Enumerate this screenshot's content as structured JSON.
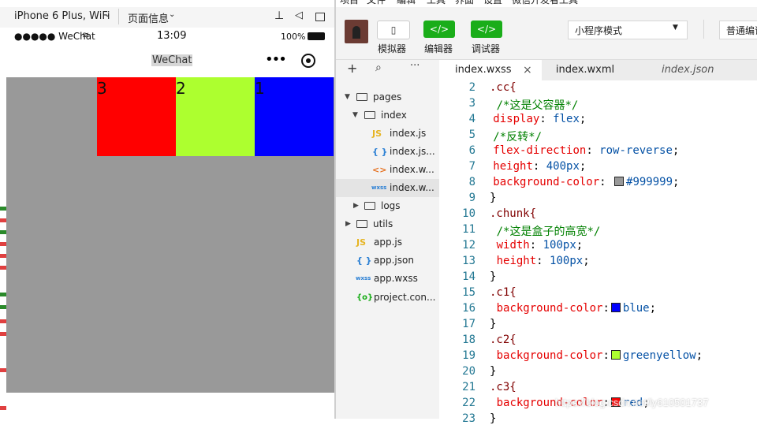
{
  "menu": [
    "项目",
    "文件",
    "编辑",
    "工具",
    "界面",
    "设置",
    "微信开发者工具"
  ],
  "device": {
    "model": "iPhone 6 Plus, WiFi",
    "page_info": "页面信息"
  },
  "status_bar": {
    "carrier": "●●●●● WeChat",
    "time": "13:09",
    "battery": "100%"
  },
  "navbar": {
    "title": "WeChat"
  },
  "stage": {
    "background": "#999999",
    "chunks": [
      {
        "label": "3",
        "color": "#ff0000"
      },
      {
        "label": "2",
        "color": "#adff2f"
      },
      {
        "label": "1",
        "color": "#0000ff"
      }
    ]
  },
  "toolbar": {
    "simulator": "模拟器",
    "editor": "编辑器",
    "debugger": "调试器",
    "mode": "小程序模式",
    "compile": "普通编译"
  },
  "tabs": [
    {
      "label": "index.wxss",
      "active": true
    },
    {
      "label": "index.wxml",
      "active": false
    },
    {
      "label": "index.json",
      "active": false
    }
  ],
  "tree": [
    {
      "label": "pages",
      "kind": "folder",
      "depth": 0,
      "expanded": true
    },
    {
      "label": "index",
      "kind": "folder",
      "depth": 1,
      "expanded": true
    },
    {
      "label": "index.js",
      "kind": "js",
      "depth": 2
    },
    {
      "label": "index.js...",
      "kind": "json",
      "depth": 2
    },
    {
      "label": "index.w...",
      "kind": "wxml",
      "depth": 2
    },
    {
      "label": "index.w...",
      "kind": "wxss",
      "depth": 2,
      "selected": true
    },
    {
      "label": "logs",
      "kind": "folder",
      "depth": 1,
      "expanded": false
    },
    {
      "label": "utils",
      "kind": "folder",
      "depth": 0,
      "expanded": false
    },
    {
      "label": "app.js",
      "kind": "js",
      "depth": 0
    },
    {
      "label": "app.json",
      "kind": "json",
      "depth": 0
    },
    {
      "label": "app.wxss",
      "kind": "wxss",
      "depth": 0
    },
    {
      "label": "project.con...",
      "kind": "config",
      "depth": 0
    }
  ],
  "code": [
    {
      "n": "2",
      "indent": 0,
      "parts": [
        [
          "sel",
          ".cc{"
        ]
      ]
    },
    {
      "n": "3",
      "indent": 2,
      "parts": [
        [
          "cmt",
          "/*这是父容器*/"
        ]
      ]
    },
    {
      "n": "4",
      "indent": 1,
      "parts": [
        [
          "prop",
          "display"
        ],
        [
          "txt",
          ": "
        ],
        [
          "val",
          "flex"
        ],
        [
          "txt",
          ";"
        ]
      ]
    },
    {
      "n": "5",
      "indent": 1,
      "parts": [
        [
          "cmt",
          "/*反转*/"
        ]
      ]
    },
    {
      "n": "6",
      "indent": 1,
      "parts": [
        [
          "prop",
          "flex-direction"
        ],
        [
          "txt",
          ": "
        ],
        [
          "val",
          "row-reverse"
        ],
        [
          "txt",
          ";"
        ]
      ]
    },
    {
      "n": "7",
      "indent": 1,
      "parts": [
        [
          "prop",
          "height"
        ],
        [
          "txt",
          ": "
        ],
        [
          "val",
          "400px"
        ],
        [
          "txt",
          ";"
        ]
      ]
    },
    {
      "n": "8",
      "indent": 1,
      "parts": [
        [
          "prop",
          "background-color"
        ],
        [
          "txt",
          ": "
        ],
        [
          "sw",
          "#999999"
        ],
        [
          "val",
          "#999999"
        ],
        [
          "txt",
          ";"
        ]
      ]
    },
    {
      "n": "9",
      "indent": 0,
      "parts": [
        [
          "txt",
          "}"
        ]
      ]
    },
    {
      "n": "10",
      "indent": 0,
      "parts": [
        [
          "sel",
          ".chunk{"
        ]
      ]
    },
    {
      "n": "11",
      "indent": 2,
      "parts": [
        [
          "cmt",
          "/*这是盒子的高宽*/"
        ]
      ]
    },
    {
      "n": "12",
      "indent": 2,
      "parts": [
        [
          "prop",
          "width"
        ],
        [
          "txt",
          ": "
        ],
        [
          "val",
          "100px"
        ],
        [
          "txt",
          ";"
        ]
      ]
    },
    {
      "n": "13",
      "indent": 2,
      "parts": [
        [
          "prop",
          "height"
        ],
        [
          "txt",
          ": "
        ],
        [
          "val",
          "100px"
        ],
        [
          "txt",
          ";"
        ]
      ]
    },
    {
      "n": "14",
      "indent": 0,
      "parts": [
        [
          "txt",
          "}"
        ]
      ]
    },
    {
      "n": "15",
      "indent": 0,
      "parts": [
        [
          "sel",
          ".c1{"
        ]
      ]
    },
    {
      "n": "16",
      "indent": 2,
      "parts": [
        [
          "prop",
          "background-color"
        ],
        [
          "txt",
          ":"
        ],
        [
          "sw",
          "#0000ff"
        ],
        [
          "val",
          "blue"
        ],
        [
          "txt",
          ";"
        ]
      ]
    },
    {
      "n": "17",
      "indent": 0,
      "parts": [
        [
          "txt",
          "}"
        ]
      ]
    },
    {
      "n": "18",
      "indent": 0,
      "parts": [
        [
          "sel",
          ".c2{"
        ]
      ]
    },
    {
      "n": "19",
      "indent": 2,
      "parts": [
        [
          "prop",
          "background-color"
        ],
        [
          "txt",
          ":"
        ],
        [
          "sw",
          "#adff2f"
        ],
        [
          "val",
          "greenyellow"
        ],
        [
          "txt",
          ";"
        ]
      ]
    },
    {
      "n": "20",
      "indent": 0,
      "parts": [
        [
          "txt",
          "}"
        ]
      ]
    },
    {
      "n": "21",
      "indent": 0,
      "parts": [
        [
          "sel",
          ".c3{"
        ]
      ]
    },
    {
      "n": "22",
      "indent": 2,
      "parts": [
        [
          "prop",
          "background-color"
        ],
        [
          "txt",
          ":"
        ],
        [
          "sw",
          "#ff0000"
        ],
        [
          "val",
          "red"
        ],
        [
          "txt",
          ";"
        ]
      ]
    },
    {
      "n": "23",
      "indent": 0,
      "parts": [
        [
          "txt",
          "}"
        ]
      ]
    }
  ],
  "watermark": "https://blog.csdn.net/ly610501737"
}
